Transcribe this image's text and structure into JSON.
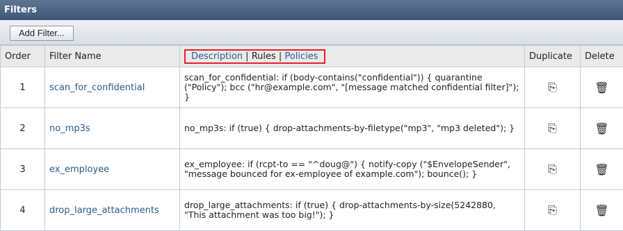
{
  "panel": {
    "title": "Filters",
    "add_button": "Add Filter..."
  },
  "columns": {
    "order": "Order",
    "filter_name": "Filter Name",
    "description": "Description",
    "sep1": " | ",
    "rules": "Rules",
    "sep2": " | ",
    "policies": "Policies",
    "duplicate": "Duplicate",
    "delete": "Delete"
  },
  "icons": {
    "duplicate": "copy-icon",
    "delete": "trash-icon"
  },
  "rows": [
    {
      "order": "1",
      "name": "scan_for_confidential",
      "description": "scan_for_confidential: if (body-contains(\"confidential\")) { quarantine (\"Policy\"); bcc (\"hr@example.com\", \"[message matched confidential filter]\"); }"
    },
    {
      "order": "2",
      "name": "no_mp3s",
      "description": "no_mp3s: if (true) { drop-attachments-by-filetype(\"mp3\", \"mp3 deleted\"); }"
    },
    {
      "order": "3",
      "name": "ex_employee",
      "description": "ex_employee: if (rcpt-to == \"^doug@\") { notify-copy (\"$EnvelopeSender\", \"message bounced for ex-employee of example.com\"); bounce(); }"
    },
    {
      "order": "4",
      "name": "drop_large_attachments",
      "description": "drop_large_attachments: if (true) { drop-attachments-by-size(5242880, \"This attachment was too big!\"); }"
    }
  ]
}
